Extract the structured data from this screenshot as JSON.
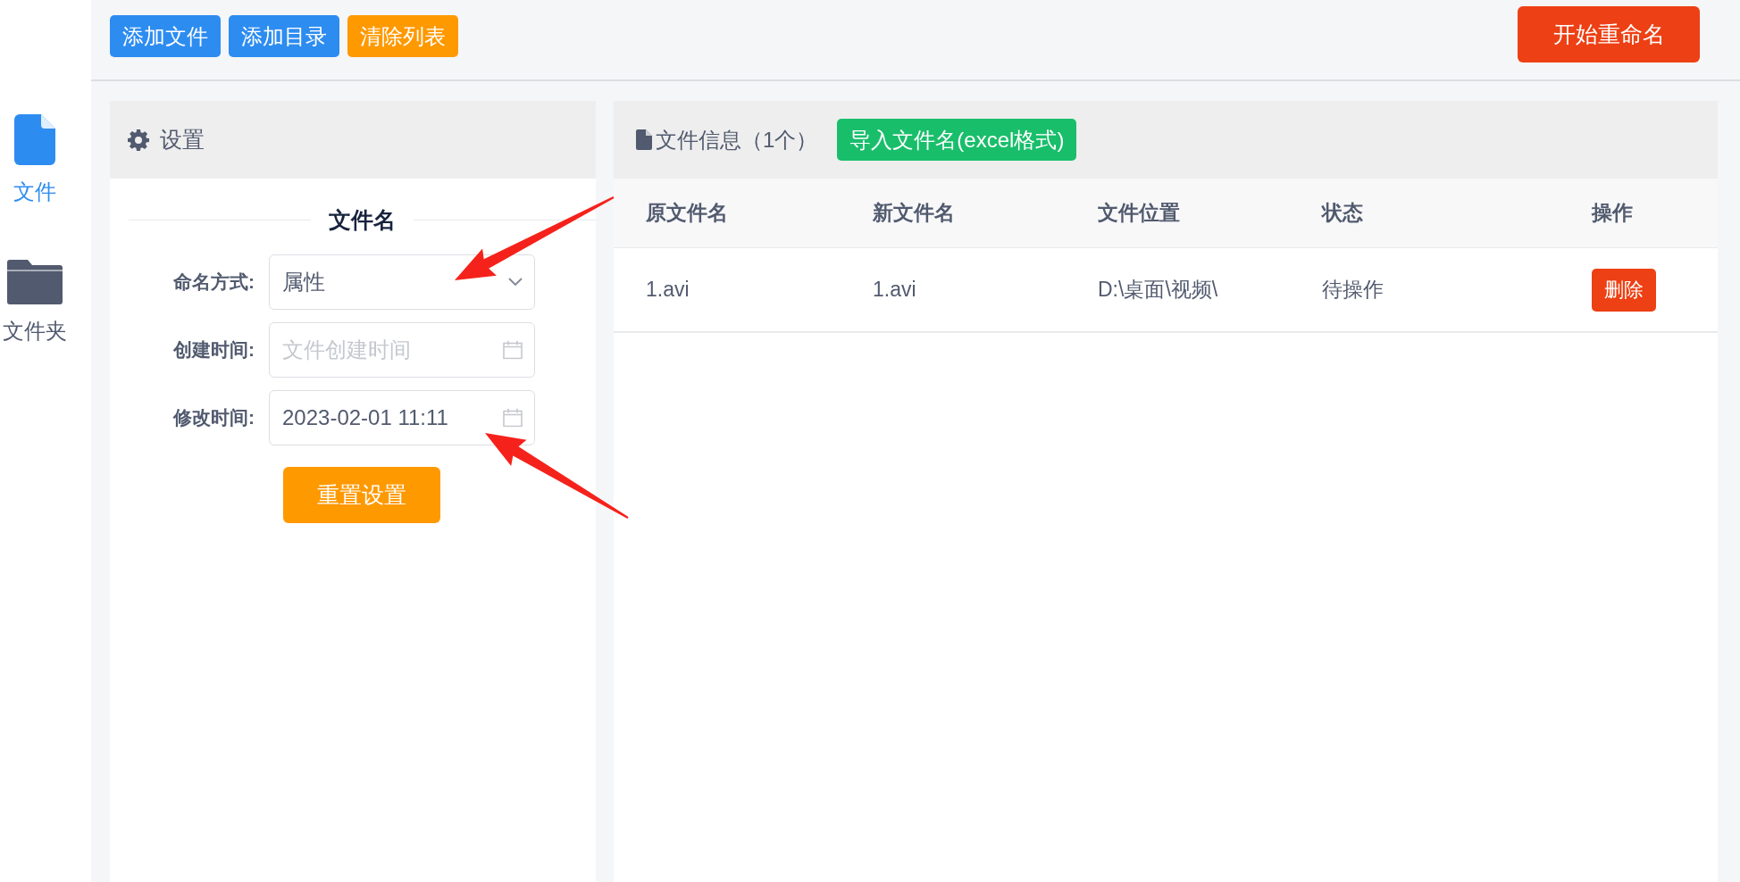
{
  "sidebar": {
    "items": [
      {
        "kind": "file",
        "label": "文件",
        "selected": true
      },
      {
        "kind": "folder",
        "label": "文件夹",
        "selected": false
      }
    ]
  },
  "toolbar": {
    "buttons": [
      {
        "label": "添加文件",
        "kind": "primary"
      },
      {
        "label": "添加目录",
        "kind": "primary"
      },
      {
        "label": "清除列表",
        "kind": "warning"
      }
    ],
    "start_button": "开始重命名"
  },
  "settings": {
    "title": "设置",
    "section_title": "文件名",
    "fields": [
      {
        "label": "命名方式:",
        "kind": "select",
        "value": "属性"
      },
      {
        "label": "创建时间:",
        "kind": "date",
        "placeholder": "文件创建时间"
      },
      {
        "label": "修改时间:",
        "kind": "date",
        "value": "2023-02-01 11:11"
      }
    ],
    "reset_button": "重置设置"
  },
  "file_info": {
    "title": "文件信息（1个）",
    "import_button": "导入文件名(excel格式)",
    "table": {
      "columns": [
        "原文件名",
        "新文件名",
        "文件位置",
        "状态",
        "操作"
      ],
      "rows": [
        {
          "original_name": "1.avi",
          "new_name": "1.avi",
          "location": "D:\\桌面\\视频\\",
          "status": "待操作",
          "action": "删除"
        }
      ]
    }
  }
}
